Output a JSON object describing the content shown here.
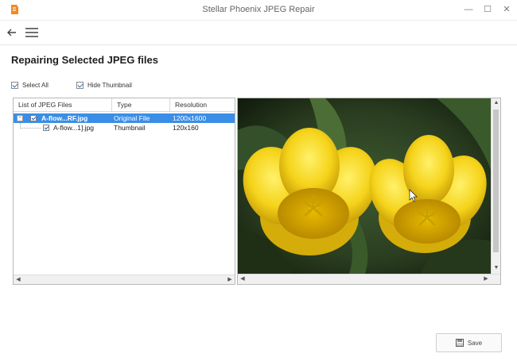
{
  "window": {
    "title": "Stellar Phoenix JPEG Repair",
    "minimize_glyph": "—",
    "maximize_glyph": "☐",
    "close_glyph": "✕"
  },
  "toolbar": {
    "back_icon": "back-arrow-icon",
    "menu_icon": "hamburger-menu-icon"
  },
  "main": {
    "heading": "Repairing Selected JPEG files",
    "select_all_label": "Select All",
    "select_all_checked": true,
    "hide_thumbnail_label": "Hide Thumbnail",
    "hide_thumbnail_checked": true
  },
  "file_list": {
    "columns": [
      "List of JPEG Files",
      "Type",
      "Resolution"
    ],
    "rows": [
      {
        "name": "A-flow...RF.jpg",
        "type": "Original File",
        "resolution": "1200x1600",
        "expanded": true,
        "checked": true,
        "selected": true
      },
      {
        "name": "A-flow...1].jpg",
        "type": "Thumbnail",
        "resolution": "120x160",
        "checked": true,
        "selected": false
      }
    ]
  },
  "preview": {
    "subject": "yellow tulips photo"
  },
  "actions": {
    "save_label": "Save"
  },
  "colors": {
    "selection": "#3a8ee6",
    "logo": "#f08a24"
  }
}
